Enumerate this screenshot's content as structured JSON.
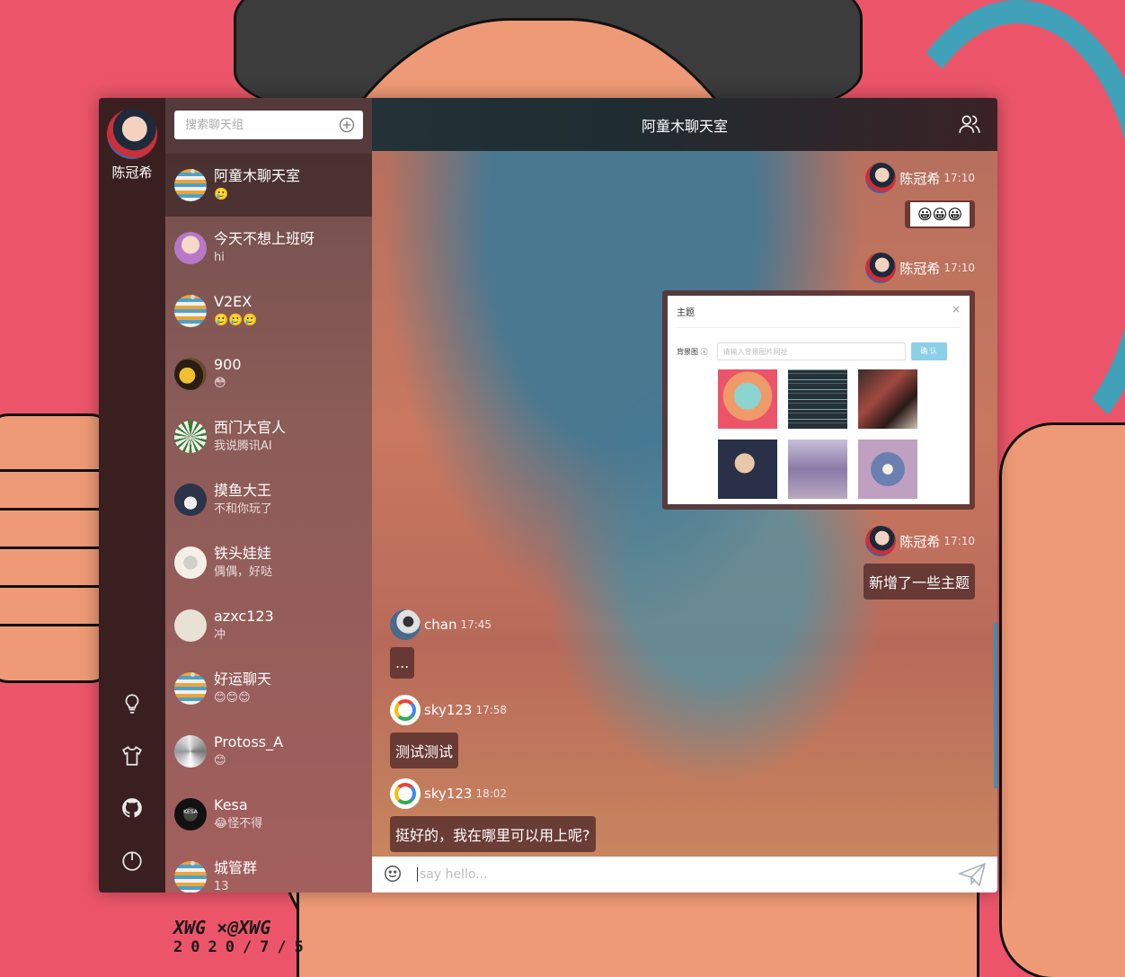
{
  "rail": {
    "user_name": "陈冠希",
    "actions": [
      "lightbulb-icon",
      "tshirt-icon",
      "github-icon",
      "power-icon"
    ]
  },
  "search": {
    "placeholder": "搜索聊天组"
  },
  "conversations": [
    {
      "name": "阿童木聊天室",
      "preview": "🥲",
      "avatar": "group",
      "active": true
    },
    {
      "name": "今天不想上班呀",
      "preview": "hi",
      "avatar": "person"
    },
    {
      "name": "V2EX",
      "preview": "🥲🥲🥲",
      "avatar": "group"
    },
    {
      "name": "900",
      "preview": "😳",
      "avatar": "person"
    },
    {
      "name": "西门大官人",
      "preview": "我说腾讯AI",
      "avatar": "person"
    },
    {
      "name": "摸鱼大王",
      "preview": "不和你玩了",
      "avatar": "person"
    },
    {
      "name": "铁头娃娃",
      "preview": "偶偶，好哒",
      "avatar": "person"
    },
    {
      "name": "azxc123",
      "preview": "冲",
      "avatar": "person"
    },
    {
      "name": "好运聊天",
      "preview": "😊😊😊",
      "avatar": "group"
    },
    {
      "name": "Protoss_A",
      "preview": "😊",
      "avatar": "person"
    },
    {
      "name": "Kesa",
      "preview": "😂怪不得",
      "avatar": "person",
      "avatar_text": "KESA"
    },
    {
      "name": "城管群",
      "preview": "13",
      "avatar": "group"
    }
  ],
  "chat": {
    "title": "阿童木聊天室",
    "messages": [
      {
        "user": "陈冠希",
        "time": "17:10",
        "content": "😀😀😀",
        "side": "right",
        "kind": "emoji"
      },
      {
        "user": "陈冠希",
        "time": "17:10",
        "content": "",
        "side": "right",
        "kind": "image",
        "image": {
          "title": "主题",
          "close": "×",
          "field_label": "背景图 ⓘ",
          "input_placeholder": "请输入背景图片网址",
          "button": "确 认"
        }
      },
      {
        "user": "陈冠希",
        "time": "17:10",
        "content": "新增了一些主题",
        "side": "right",
        "kind": "text"
      },
      {
        "user": "chan",
        "time": "17:45",
        "content": "...",
        "side": "left",
        "kind": "text"
      },
      {
        "user": "sky123",
        "time": "17:58",
        "content": "测试测试",
        "side": "left",
        "kind": "text"
      },
      {
        "user": "sky123",
        "time": "18:02",
        "content": "挺好的，我在哪里可以用上呢?",
        "side": "left",
        "kind": "text"
      }
    ]
  },
  "composer": {
    "placeholder": "say hello..."
  },
  "watermark": {
    "line1": "XWG ×@XWG",
    "line2": "2020/7/5"
  },
  "colors": {
    "background": "#ec5569",
    "rail": "#3a1f21",
    "bubble": "#552d2d",
    "scrollbar": "#3f8fb0"
  }
}
